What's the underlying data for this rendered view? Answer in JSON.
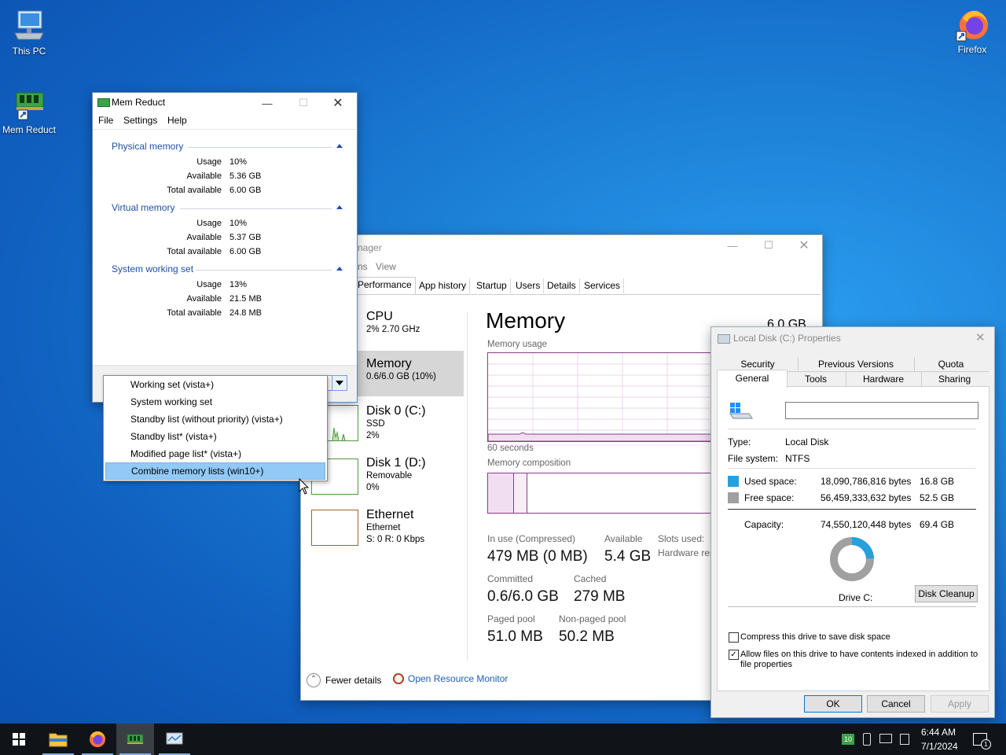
{
  "desktop": {
    "icons": [
      {
        "label": "This PC",
        "icon": "computer-icon"
      },
      {
        "label": "Mem Reduct",
        "icon": "memory-chip-icon"
      },
      {
        "label": "Firefox",
        "icon": "firefox-icon"
      }
    ]
  },
  "mem_reduct": {
    "title": "Mem Reduct",
    "menu": [
      "File",
      "Settings",
      "Help"
    ],
    "sections": [
      {
        "name": "Physical memory",
        "rows": [
          {
            "label": "Usage",
            "value": "10%"
          },
          {
            "label": "Available",
            "value": "5.36 GB"
          },
          {
            "label": "Total available",
            "value": "6.00 GB"
          }
        ]
      },
      {
        "name": "Virtual memory",
        "rows": [
          {
            "label": "Usage",
            "value": "10%"
          },
          {
            "label": "Available",
            "value": "5.37 GB"
          },
          {
            "label": "Total available",
            "value": "6.00 GB"
          }
        ]
      },
      {
        "name": "System working set",
        "rows": [
          {
            "label": "Usage",
            "value": "13%"
          },
          {
            "label": "Available",
            "value": "21.5 MB"
          },
          {
            "label": "Total available",
            "value": "24.8 MB"
          }
        ]
      }
    ],
    "dropdown_items": [
      "Working set (vista+)",
      "System working set",
      "Standby list (without priority) (vista+)",
      "Standby list* (vista+)",
      "Modified page list* (vista+)",
      "Combine memory lists (win10+)"
    ],
    "selected_index": 5
  },
  "task_manager": {
    "title_partial": "nager",
    "menu": [
      "ns",
      "View"
    ],
    "tabs": [
      "Performance",
      "App history",
      "Startup",
      "Users",
      "Details",
      "Services"
    ],
    "active_tab": "Performance",
    "sidebar": [
      {
        "title": "CPU",
        "line1": "2% 2.70 GHz",
        "line2": "",
        "line3": ""
      },
      {
        "title": "Memory",
        "line1": "0.6/6.0 GB (10%)",
        "line2": "",
        "line3": ""
      },
      {
        "title": "Disk 0 (C:)",
        "line1": "SSD",
        "line2": "2%",
        "line3": ""
      },
      {
        "title": "Disk 1 (D:)",
        "line1": "Removable",
        "line2": "0%",
        "line3": ""
      },
      {
        "title": "Ethernet",
        "line1": "Ethernet",
        "line2": "S: 0 R: 0 Kbps",
        "line3": ""
      }
    ],
    "heading": "Memory",
    "capacity": "6.0 GB",
    "usage_label": "Memory usage",
    "time_label": "60 seconds",
    "composition_label": "Memory composition",
    "stats": {
      "in_use_label": "In use (Compressed)",
      "in_use": "479 MB (0 MB)",
      "available_label": "Available",
      "available": "5.4 GB",
      "slots_label": "Slots used:",
      "hw_label": "Hardware res",
      "committed_label": "Committed",
      "committed": "0.6/6.0 GB",
      "cached_label": "Cached",
      "cached": "279 MB",
      "paged_label": "Paged pool",
      "paged": "51.0 MB",
      "nonpaged_label": "Non-paged pool",
      "nonpaged": "50.2 MB"
    },
    "fewer_details": "Fewer details",
    "open_resmon": "Open Resource Monitor"
  },
  "properties": {
    "title": "Local Disk (C:) Properties",
    "tabs_row1": [
      "Security",
      "Previous Versions",
      "Quota"
    ],
    "tabs_row2": [
      "General",
      "Tools",
      "Hardware",
      "Sharing"
    ],
    "active_tab": "General",
    "name_value": "",
    "type_label": "Type:",
    "type_value": "Local Disk",
    "fs_label": "File system:",
    "fs_value": "NTFS",
    "used_label": "Used space:",
    "used_bytes": "18,090,786,816 bytes",
    "used_gb": "16.8 GB",
    "free_label": "Free space:",
    "free_bytes": "56,459,333,632 bytes",
    "free_gb": "52.5 GB",
    "cap_label": "Capacity:",
    "cap_bytes": "74,550,120,448 bytes",
    "cap_gb": "69.4 GB",
    "used_fraction": 0.2427,
    "drive_label": "Drive C:",
    "cleanup": "Disk Cleanup",
    "compress_label": "Compress this drive to save disk space",
    "compress_checked": false,
    "index_label_1": "Allow files on this drive to have contents indexed in addition to",
    "index_label_2": "file properties",
    "index_checked": true,
    "ok": "OK",
    "cancel": "Cancel",
    "apply": "Apply",
    "used_color": "#26a0da",
    "free_color": "#a0a0a0"
  },
  "taskbar": {
    "apps": [
      "start-icon",
      "file-explorer-icon",
      "firefox-icon",
      "mem-reduct-icon",
      "task-manager-icon"
    ],
    "tray_badge": "10",
    "time": "6:44 AM",
    "date": "7/1/2024",
    "notification_count": "1"
  }
}
